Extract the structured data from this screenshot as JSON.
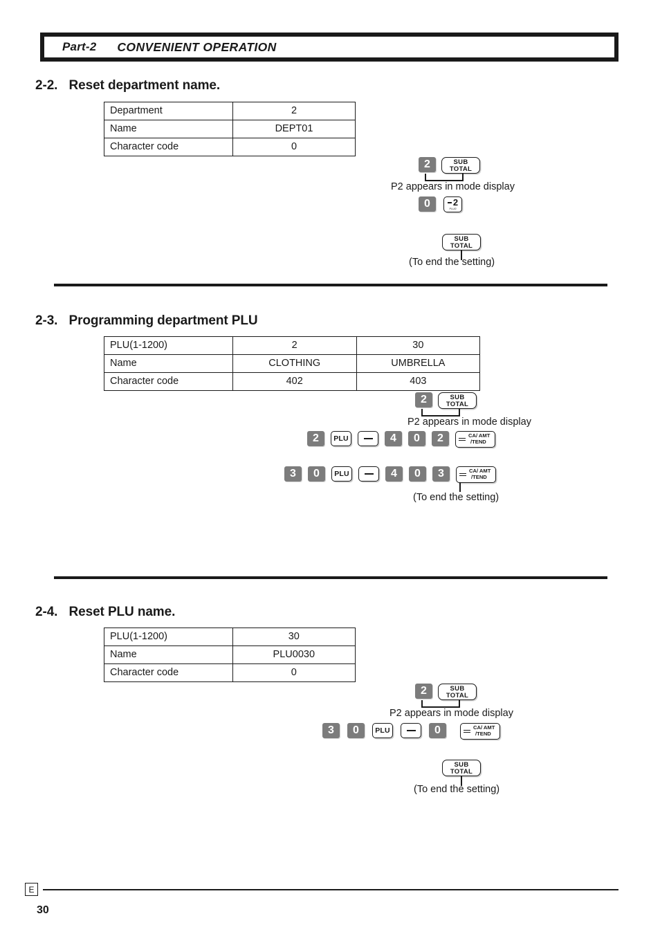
{
  "header": {
    "part_label": "Part-2",
    "title": "CONVENIENT OPERATION"
  },
  "sections": [
    {
      "number": "2-2.",
      "title": "Reset department name.",
      "table": {
        "rows": [
          {
            "label": "Department",
            "values": [
              "2"
            ]
          },
          {
            "label": "Name",
            "values": [
              "DEPT01"
            ]
          },
          {
            "label": "Character code",
            "values": [
              "0"
            ]
          }
        ]
      },
      "steps": {
        "mode_key_digit": "2",
        "mode_key_sub": "SUB",
        "mode_key_total": "TOTAL",
        "mode_caption": "P2 appears in mode display",
        "entry_digit": "0",
        "entry_key_num": "2",
        "entry_key_sub": "PLU/2",
        "end_key_sub": "SUB",
        "end_key_total": "TOTAL",
        "end_caption": "(To end the setting)"
      }
    },
    {
      "number": "2-3.",
      "title": "Programming department PLU",
      "table": {
        "rows": [
          {
            "label": "PLU(1-1200)",
            "values": [
              "2",
              "30"
            ]
          },
          {
            "label": "Name",
            "values": [
              "CLOTHING",
              "UMBRELLA"
            ]
          },
          {
            "label": "Character code",
            "values": [
              "402",
              "403"
            ]
          }
        ]
      },
      "steps": {
        "mode_key_digit": "2",
        "mode_key_sub": "SUB",
        "mode_key_total": "TOTAL",
        "mode_caption": "P2 appears in mode display",
        "seq1": [
          "2",
          "PLU",
          "minus",
          "4",
          "0",
          "2",
          "catend"
        ],
        "seq2": [
          "3",
          "0",
          "PLU",
          "minus",
          "4",
          "0",
          "3",
          "catend"
        ],
        "end_caption": "(To end the setting)"
      }
    },
    {
      "number": "2-4.",
      "title": "Reset PLU name.",
      "table": {
        "rows": [
          {
            "label": "PLU(1-1200)",
            "values": [
              "30"
            ]
          },
          {
            "label": "Name",
            "values": [
              "PLU0030"
            ]
          },
          {
            "label": "Character code",
            "values": [
              "0"
            ]
          }
        ]
      },
      "steps": {
        "mode_key_digit": "2",
        "mode_key_sub": "SUB",
        "mode_key_total": "TOTAL",
        "mode_caption": "P2 appears in mode display",
        "seq1": [
          "3",
          "0",
          "PLU",
          "minus",
          "0",
          "catend"
        ],
        "end_key_sub": "SUB",
        "end_key_total": "TOTAL",
        "end_caption": "(To end the setting)"
      }
    }
  ],
  "keys": {
    "plu_label": "PLU",
    "catend_line1": "CA/ AMT",
    "catend_line2": "/TEND",
    "minus2_num": "2",
    "minus2_sub": "PLU/2"
  },
  "footer": {
    "language_mark": "E",
    "page_number": "30"
  }
}
